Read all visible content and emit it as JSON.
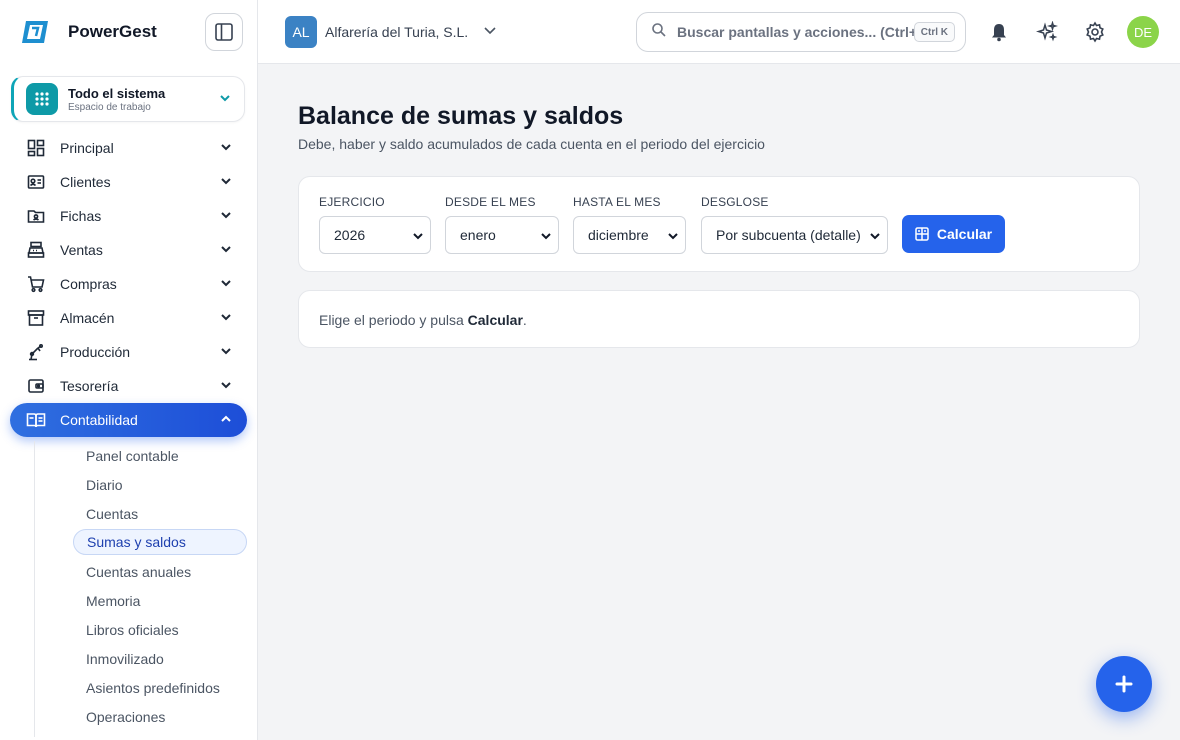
{
  "brand": {
    "name": "PowerGest"
  },
  "workspace": {
    "title": "Todo el sistema",
    "subtitle": "Espacio de trabajo"
  },
  "nav": {
    "items": [
      {
        "label": "Principal",
        "icon": "dashboard-icon"
      },
      {
        "label": "Clientes",
        "icon": "contact-card-icon"
      },
      {
        "label": "Fichas",
        "icon": "folder-icon"
      },
      {
        "label": "Ventas",
        "icon": "cash-register-icon"
      },
      {
        "label": "Compras",
        "icon": "cart-icon"
      },
      {
        "label": "Almacén",
        "icon": "archive-icon"
      },
      {
        "label": "Producción",
        "icon": "robot-arm-icon"
      },
      {
        "label": "Tesorería",
        "icon": "wallet-icon"
      },
      {
        "label": "Contabilidad",
        "icon": "book-icon",
        "active": true
      }
    ],
    "sub_items": [
      "Panel contable",
      "Diario",
      "Cuentas",
      "Sumas y saldos",
      "Cuentas anuales",
      "Memoria",
      "Libros oficiales",
      "Inmovilizado",
      "Asientos predefinidos",
      "Operaciones"
    ],
    "selected_sub": "Sumas y saldos"
  },
  "topbar": {
    "company_initials": "AL",
    "company_name": "Alfarería del Turia, S.L.",
    "search_placeholder": "Buscar pantallas y acciones... (Ctrl+I",
    "search_shortcut": "Ctrl K",
    "user_initials": "DE"
  },
  "page": {
    "title": "Balance de sumas y saldos",
    "subtitle": "Debe, haber y saldo acumulados de cada cuenta en el periodo del ejercicio"
  },
  "filters": {
    "ejercicio": {
      "label": "EJERCICIO",
      "value": "2026"
    },
    "desde": {
      "label": "DESDE EL MES",
      "value": "enero"
    },
    "hasta": {
      "label": "HASTA EL MES",
      "value": "diciembre"
    },
    "desglose": {
      "label": "DESGLOSE",
      "value": "Por subcuenta (detalle)"
    },
    "calc_label": "Calcular"
  },
  "message": {
    "prefix": "Elige el periodo y pulsa ",
    "action": "Calcular",
    "suffix": "."
  },
  "colors": {
    "accent": "#2563eb",
    "workspace": "#0e9aa7",
    "avatar": "#8bd449",
    "company_badge": "#3b82c4"
  }
}
